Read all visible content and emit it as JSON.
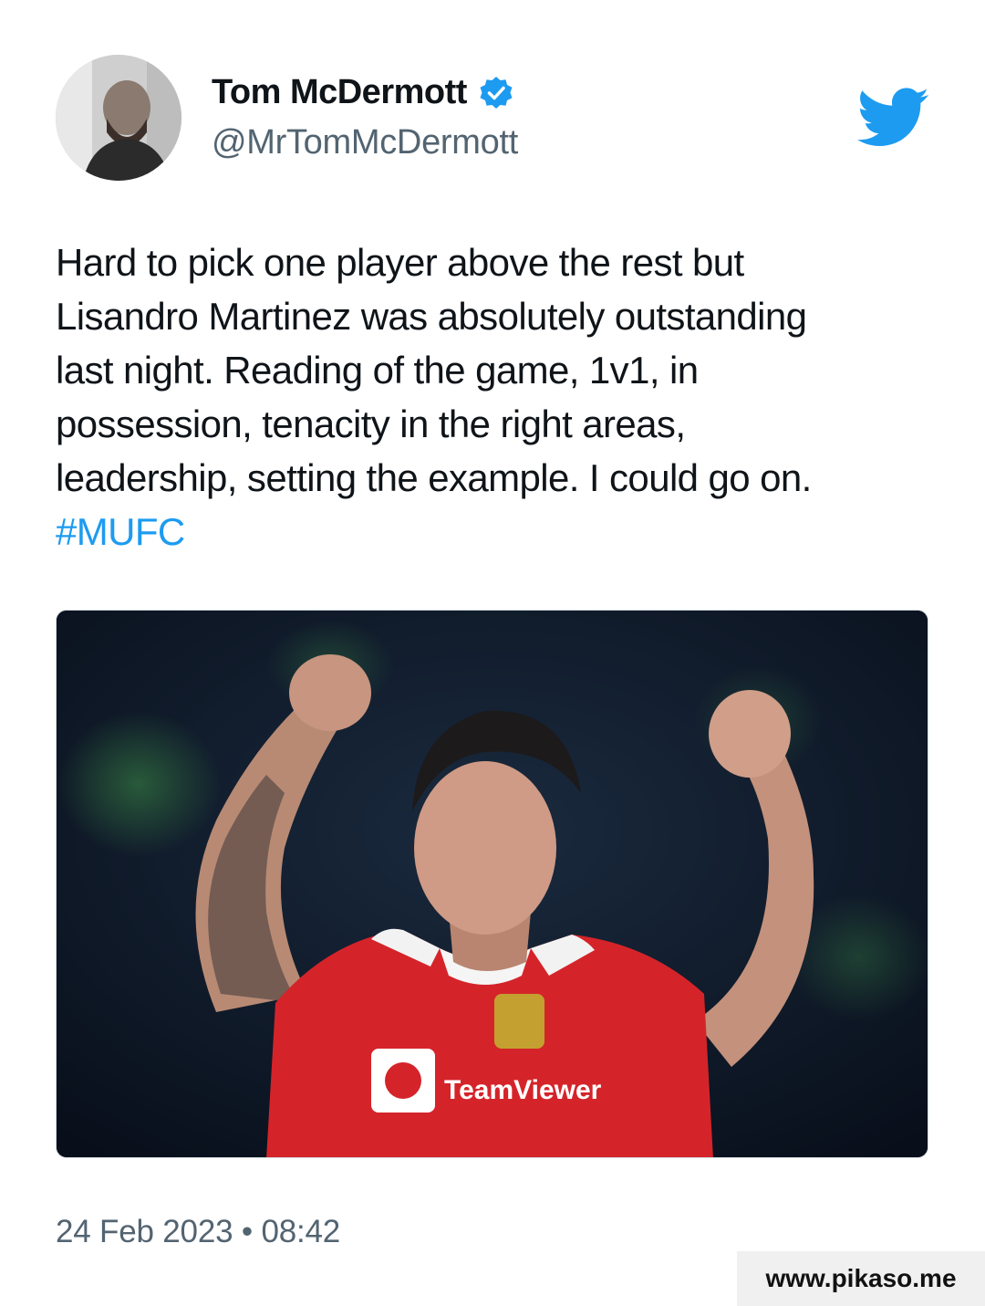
{
  "author": {
    "display_name": "Tom McDermott",
    "handle": "@MrTomMcDermott",
    "verified": true,
    "avatar_icon": "profile-photo"
  },
  "platform_icon": "twitter-bird-icon",
  "tweet": {
    "text": "Hard to pick one player above the rest but\nLisandro Martinez was absolutely outstanding\nlast night. Reading of the game, 1v1, in\npossession, tenacity in the right areas,\nleadership, setting the example. I could go on.",
    "hashtag": "#MUFC"
  },
  "media": {
    "kind": "photo",
    "jersey_sponsor": "TeamViewer"
  },
  "timestamp": "24 Feb 2023 • 08:42",
  "watermark": "www.pikaso.me",
  "colors": {
    "link": "#1d9bf0",
    "twitter_blue": "#1d9bf0",
    "secondary_text": "#536471"
  }
}
